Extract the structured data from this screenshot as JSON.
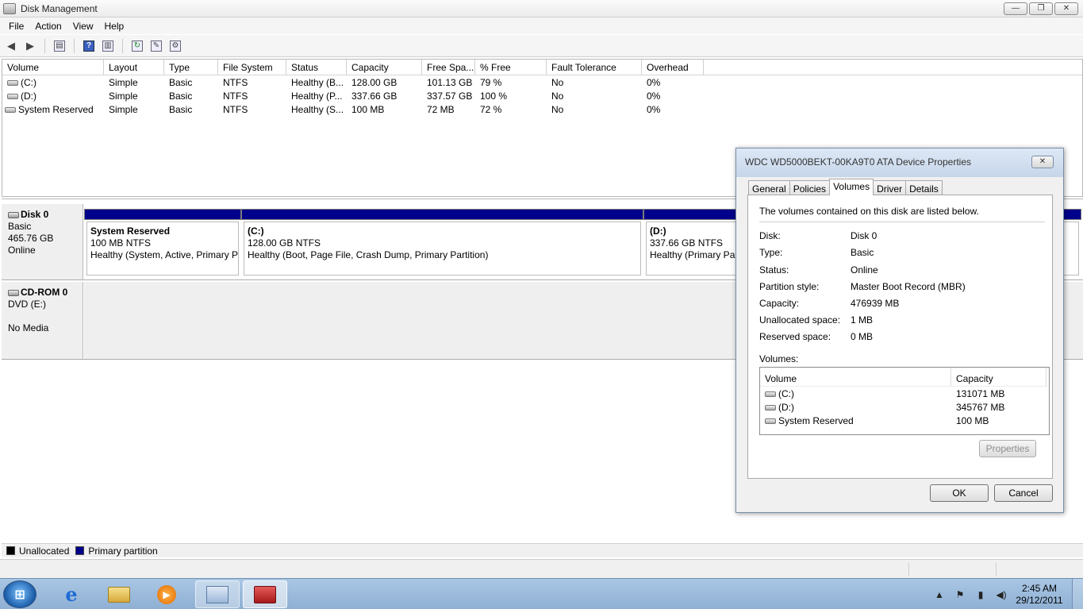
{
  "window": {
    "title": "Disk Management",
    "buttons": {
      "minimize": "—",
      "restore": "❐",
      "close": "✕"
    }
  },
  "menu": [
    "File",
    "Action",
    "View",
    "Help"
  ],
  "volume_list": {
    "columns": [
      "Volume",
      "Layout",
      "Type",
      "File System",
      "Status",
      "Capacity",
      "Free Spa...",
      "% Free",
      "Fault Tolerance",
      "Overhead"
    ],
    "rows": [
      [
        "(C:)",
        "Simple",
        "Basic",
        "NTFS",
        "Healthy (B...",
        "128.00 GB",
        "101.13 GB",
        "79 %",
        "No",
        "0%"
      ],
      [
        "(D:)",
        "Simple",
        "Basic",
        "NTFS",
        "Healthy (P...",
        "337.66 GB",
        "337.57 GB",
        "100 %",
        "No",
        "0%"
      ],
      [
        "System Reserved",
        "Simple",
        "Basic",
        "NTFS",
        "Healthy (S...",
        "100 MB",
        "72 MB",
        "72 %",
        "No",
        "0%"
      ]
    ]
  },
  "disks": {
    "disk0": {
      "name": "Disk 0",
      "type": "Basic",
      "size": "465.76 GB",
      "state": "Online",
      "partitions": [
        {
          "name": "System Reserved",
          "size": "100 MB NTFS",
          "status": "Healthy (System, Active, Primary P"
        },
        {
          "name": "(C:)",
          "size": "128.00 GB NTFS",
          "status": "Healthy (Boot, Page File, Crash Dump, Primary Partition)"
        },
        {
          "name": "(D:)",
          "size": "337.66 GB NTFS",
          "status": "Healthy (Primary Par"
        }
      ]
    },
    "cdrom0": {
      "name": "CD-ROM 0",
      "type": "DVD (E:)",
      "media": "No Media"
    }
  },
  "legend": {
    "unallocated": "Unallocated",
    "primary": "Primary partition",
    "colors": {
      "unallocated": "#000000",
      "primary": "#00008b"
    }
  },
  "dialog": {
    "title": "WDC WD5000BEKT-00KA9T0 ATA Device Properties",
    "tabs": [
      "General",
      "Policies",
      "Volumes",
      "Driver",
      "Details"
    ],
    "selected_tab": "Volumes",
    "intro": "The volumes contained on this disk are listed below.",
    "properties": [
      {
        "label": "Disk:",
        "value": "Disk 0"
      },
      {
        "label": "Type:",
        "value": "Basic"
      },
      {
        "label": "Status:",
        "value": "Online"
      },
      {
        "label": "Partition style:",
        "value": "Master Boot Record (MBR)"
      },
      {
        "label": "Capacity:",
        "value": "476939 MB"
      },
      {
        "label": "Unallocated space:",
        "value": "1 MB"
      },
      {
        "label": "Reserved space:",
        "value": "0 MB"
      }
    ],
    "volumes_label": "Volumes:",
    "volumes_columns": [
      "Volume",
      "Capacity"
    ],
    "volumes": [
      {
        "name": "(C:)",
        "capacity": "131071 MB"
      },
      {
        "name": "(D:)",
        "capacity": "345767 MB"
      },
      {
        "name": "System Reserved",
        "capacity": "100 MB"
      }
    ],
    "properties_button": "Properties",
    "ok_button": "OK",
    "cancel_button": "Cancel"
  },
  "taskbar": {
    "clock_time": "2:45 AM",
    "clock_date": "29/12/2011"
  }
}
